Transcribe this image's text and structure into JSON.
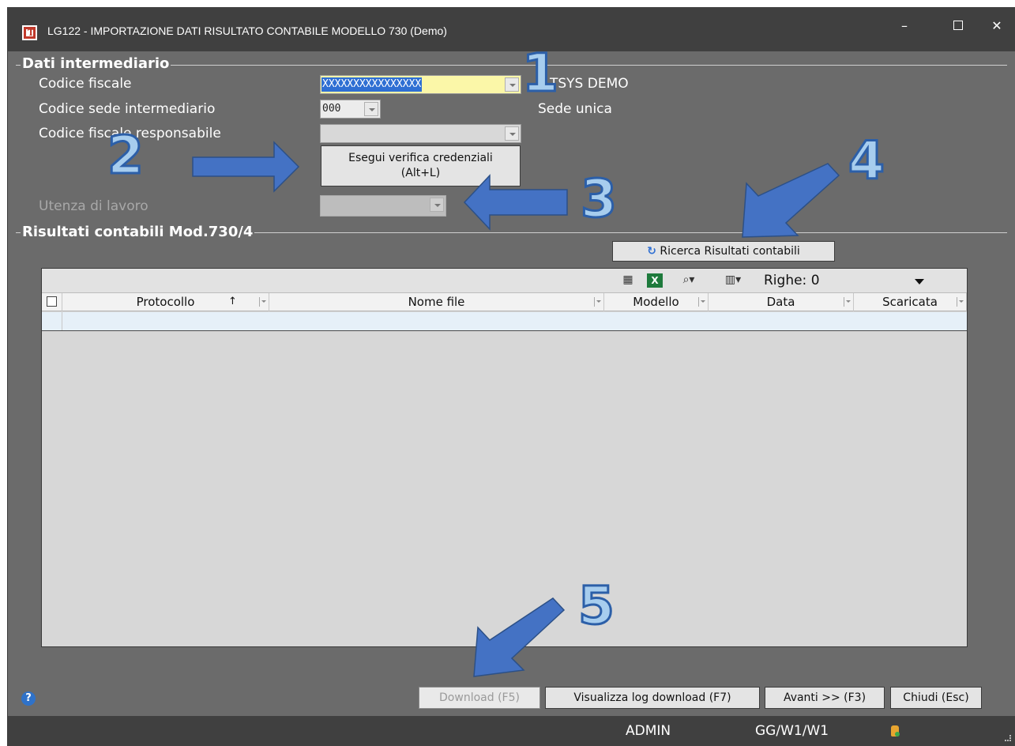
{
  "window": {
    "title": "LG122 - IMPORTAZIONE DATI RISULTATO CONTABILE MODELLO 730  (Demo)",
    "app_icon_letter": "T",
    "minimize": "–",
    "close": "✕"
  },
  "intermediario": {
    "group_title": "Dati intermediario",
    "codice_fiscale_label": "Codice fiscale",
    "codice_fiscale_value": "XXXXXXXXXXXXXXXX",
    "codice_fiscale_name": "TSYS DEMO",
    "codice_sede_label": "Codice sede intermediario",
    "codice_sede_value": "000",
    "codice_sede_desc": "Sede unica",
    "cf_responsabile_label": "Codice fiscale responsabile",
    "cf_responsabile_value": "",
    "verify_button_line1": "Esegui verifica credenziali",
    "verify_button_line2": "(Alt+L)",
    "utenza_label": "Utenza di lavoro",
    "utenza_value": ""
  },
  "risultati": {
    "group_title": "Risultati contabili Mod.730/4",
    "search_button": "Ricerca Risultati contabili",
    "rows_label": "Righe: 0",
    "columns": [
      "Protocollo",
      "Nome file",
      "Modello",
      "Data",
      "Scaricata"
    ],
    "sort_indicator": "↑"
  },
  "footer": {
    "download": "Download (F5)",
    "log": "Visualizza log download (F7)",
    "avanti": "Avanti >> (F3)",
    "chiudi": "Chiudi (Esc)",
    "help": "?"
  },
  "statusbar": {
    "user": "ADMIN",
    "path": "GG/W1/W1"
  },
  "annotations": {
    "n1": "1",
    "n2": "2",
    "n3": "3",
    "n4": "4",
    "n5": "5",
    "arrow_color": "#4472c4"
  },
  "icons": [
    "help-icon",
    "refresh-icon",
    "export-icon",
    "excel-icon",
    "search-icon",
    "column-chooser-icon",
    "db-icon"
  ]
}
